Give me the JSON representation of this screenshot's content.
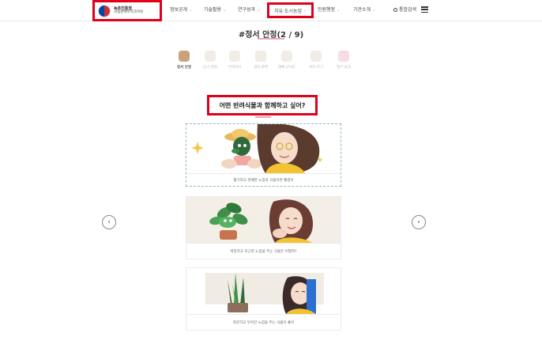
{
  "header": {
    "logo": {
      "line1": "농촌진흥청",
      "line2": "국립원예특작과학원"
    },
    "nav": [
      {
        "label": "정보공개",
        "chevron": "⌄"
      },
      {
        "label": "기술활용",
        "chevron": "⌄"
      },
      {
        "label": "연구성과",
        "chevron": "⌄"
      },
      {
        "label": "치유·도시농업",
        "chevron": "⌄"
      },
      {
        "label": "민원행정",
        "chevron": "⌄"
      },
      {
        "label": "기관소개",
        "chevron": "⌄"
      }
    ],
    "search_label": "통합검색",
    "accent_box_color": "#e0001b"
  },
  "page": {
    "title": "#정서 안정(2 / 9)"
  },
  "steps": [
    {
      "label": "정서 안정",
      "active": true
    },
    {
      "label": "공기 정화",
      "active": false
    },
    {
      "label": "인테리어",
      "active": false
    },
    {
      "label": "생육 환경",
      "active": false
    },
    {
      "label": "재배 난이도",
      "active": false
    },
    {
      "label": "관리 주기",
      "active": false
    },
    {
      "label": "향기 효과",
      "active": false
    }
  ],
  "question": "어떤 반려식물과 함께하고 싶어?",
  "cards": [
    {
      "caption": "활기차고 경쾌한 느낌의 식물이면 좋겠어"
    },
    {
      "caption": "따뜻하고 포근한 느낌을 주는 식물은 어떨까?"
    },
    {
      "caption": "차분하고 우아한 느낌을 주는 식물이 좋아"
    }
  ],
  "carousel": {
    "prev": "‹",
    "next": "›"
  }
}
